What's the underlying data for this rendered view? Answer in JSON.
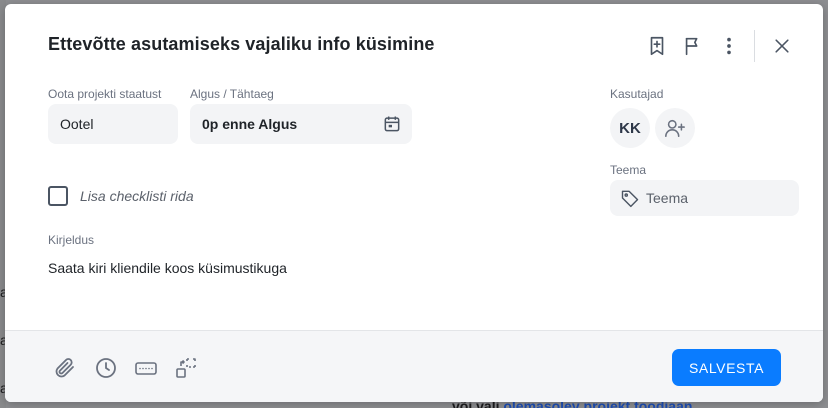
{
  "modal": {
    "title": "Ettevõtte asutamiseks vajaliku info küsimine"
  },
  "fields": {
    "status_label": "Oota projekti staatust",
    "status_value": "Ootel",
    "date_label": "Algus / Tähtaeg",
    "date_value": "0p enne Algus",
    "users_label": "Kasutajad",
    "user_initials": "KK",
    "topic_label": "Teema",
    "topic_placeholder": "Teema"
  },
  "checklist": {
    "placeholder": "Lisa checklisti rida"
  },
  "description": {
    "label": "Kirjeldus",
    "text": "Saata kiri kliendile koos küsimustikuga"
  },
  "footer": {
    "save_label": "SALVESTA"
  },
  "background": {
    "fragment_a": "a",
    "fragment_b": "a",
    "fragment_c": "a",
    "fragment_bottom_prefix": "või vali",
    "fragment_bottom_link": "olemasolev projekt toodiaan"
  },
  "colors": {
    "accent": "#0a7cff",
    "surface": "#f3f4f6",
    "text": "#1f2328",
    "muted": "#6b7280"
  },
  "icons": {
    "header": [
      "bookmark-plus-icon",
      "flag-icon",
      "more-vertical-icon",
      "close-icon"
    ],
    "footer": [
      "paperclip-icon",
      "clock-icon",
      "keyboard-icon",
      "convert-icon"
    ],
    "date": "calendar-icon",
    "add_user": "user-plus-icon",
    "tag": "tag-icon"
  }
}
